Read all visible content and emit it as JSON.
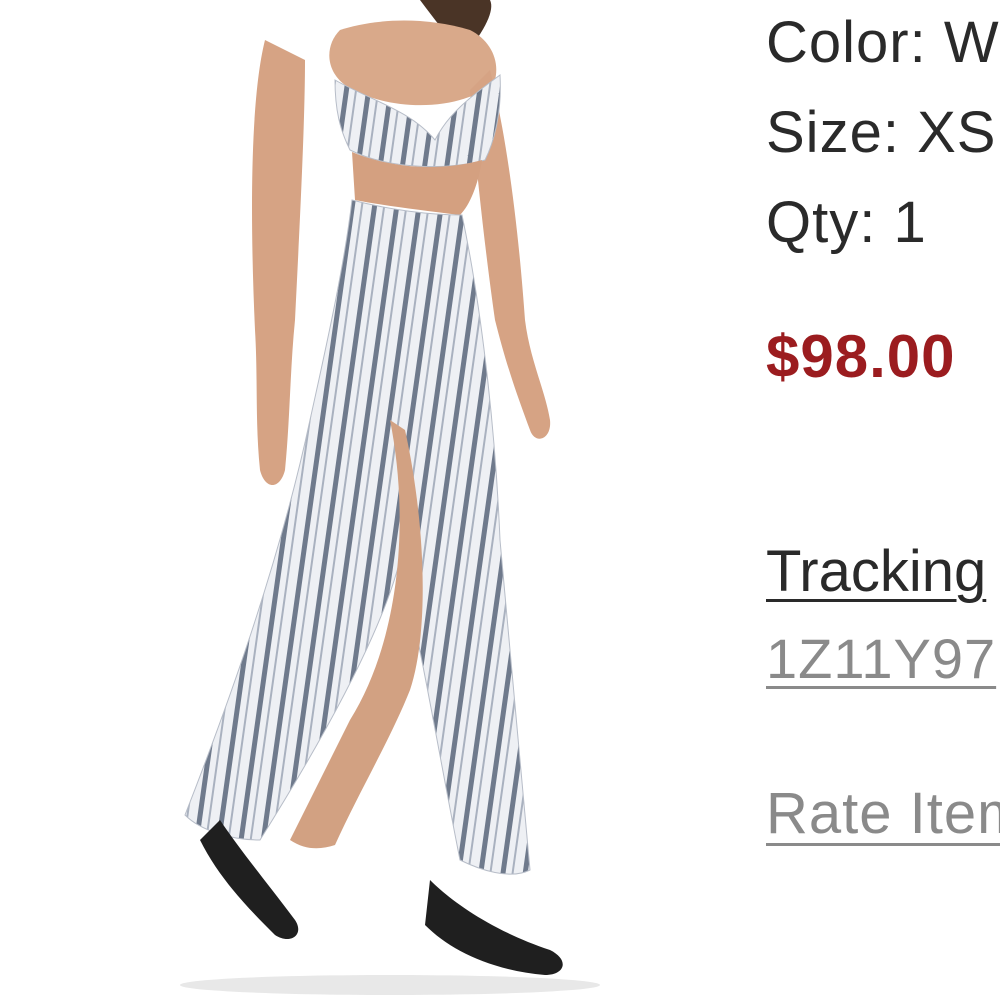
{
  "product": {
    "image_label": "striped-maxi-dress-photo",
    "color_label": "Color:",
    "color_value": "W",
    "size_label": "Size:",
    "size_value": "XS",
    "qty_label": "Qty:",
    "qty_value": "1",
    "price": "$98.00"
  },
  "shipping": {
    "tracking_label": "Tracking",
    "tracking_number": "1Z11Y97"
  },
  "actions": {
    "rate_item_label": "Rate Item"
  },
  "colors": {
    "price": "#9b1c1f",
    "text": "#2a2a2a",
    "link_muted": "#8a8a8a",
    "background": "#ffffff"
  }
}
